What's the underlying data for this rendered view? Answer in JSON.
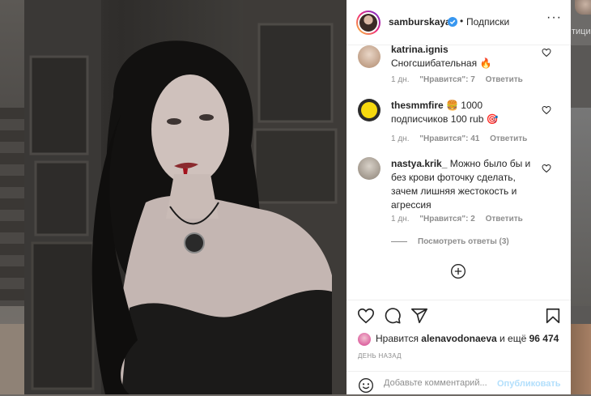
{
  "backdrop": {
    "right_label": "тиции"
  },
  "header": {
    "username": "samburskaya",
    "dot": "•",
    "follow_status": "Подписки",
    "more": "···"
  },
  "comments": [
    {
      "user": "katrina.ignis",
      "text": "Сногсшибательная 🔥",
      "time": "1 дн.",
      "likes": "\"Нравится\": 7",
      "reply": "Ответить"
    },
    {
      "user": "thesmmfire",
      "text": "🍔 1000 подписчиков 100 rub 🎯",
      "time": "1 дн.",
      "likes": "\"Нравится\": 41",
      "reply": "Ответить"
    },
    {
      "user": "nastya.krik_",
      "text": "Можно было бы и без крови фоточку сделать, зачем лишняя жестокость и агрессия",
      "time": "1 дн.",
      "likes": "\"Нравится\": 2",
      "reply": "Ответить"
    }
  ],
  "view_replies": "Посмотреть ответы (3)",
  "likes_summary": {
    "prefix": "Нравится",
    "user": "alenavodonaeva",
    "middle": "и ещё",
    "count": "96 474"
  },
  "time_ago": "ДЕНЬ НАЗАД",
  "add_comment": {
    "placeholder": "Добавьте комментарий...",
    "post_label": "Опубликовать"
  },
  "colors": {
    "accent": "#0095f6",
    "post_disabled": "#b2dffc",
    "verified": "#3897f0",
    "blood": "#a3121c"
  },
  "icons": [
    "heart-icon",
    "comment-icon",
    "share-icon",
    "bookmark-icon",
    "emoji-icon",
    "plus-circle-icon",
    "verified-badge-icon"
  ]
}
